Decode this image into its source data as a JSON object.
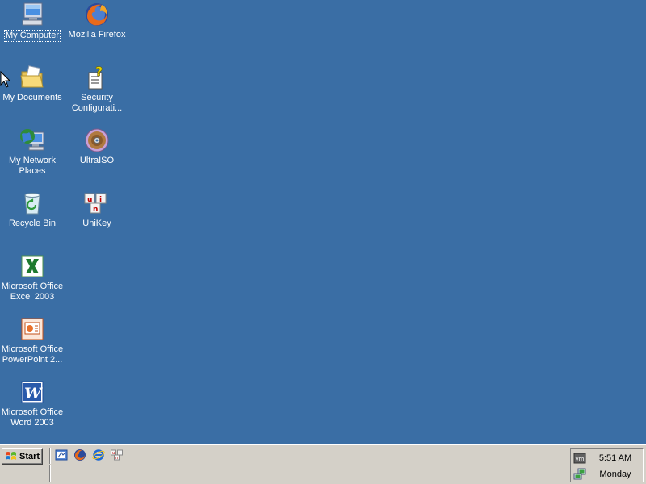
{
  "desktop": {
    "background_color": "#3a6ea5",
    "icons": [
      {
        "label": "My Computer",
        "icon": "my-computer-icon"
      },
      {
        "label": "Mozilla Firefox",
        "icon": "firefox-icon"
      },
      {
        "label": "My Documents",
        "icon": "my-documents-icon"
      },
      {
        "label": "Security Configurati...",
        "icon": "security-configuration-icon"
      },
      {
        "label": "My Network Places",
        "icon": "network-places-icon"
      },
      {
        "label": "UltraISO",
        "icon": "ultraiso-icon"
      },
      {
        "label": "Recycle Bin",
        "icon": "recycle-bin-icon"
      },
      {
        "label": "UniKey",
        "icon": "unikey-icon"
      },
      {
        "label": "Microsoft Office Excel 2003",
        "icon": "excel-icon"
      },
      {
        "label": "Microsoft Office PowerPoint 2...",
        "icon": "powerpoint-icon"
      },
      {
        "label": "Microsoft Office Word 2003",
        "icon": "word-icon"
      }
    ]
  },
  "taskbar": {
    "start_label": "Start",
    "quick_launch": [
      "show-desktop-icon",
      "firefox-icon",
      "internet-explorer-icon",
      "unikey-icon"
    ],
    "tray": {
      "icons": [
        "vmware-tools-icon",
        "network-connection-icon"
      ],
      "time": "5:51 AM",
      "day": "Monday"
    }
  }
}
